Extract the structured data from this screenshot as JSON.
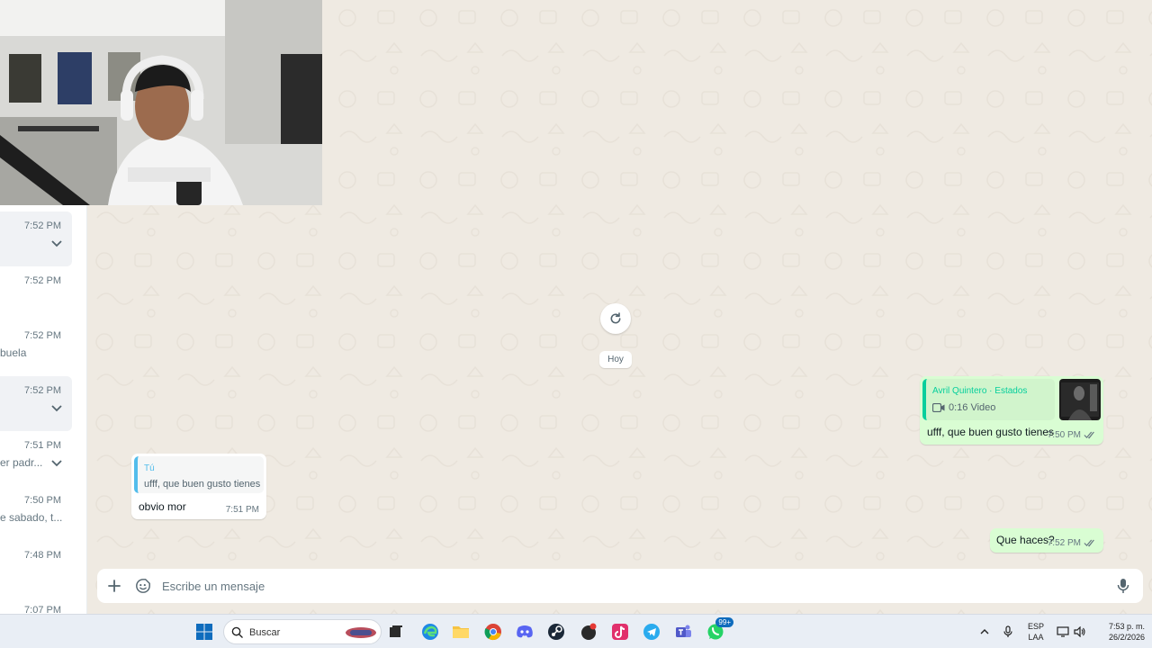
{
  "sidebar": {
    "items": [
      {
        "time": "7:52 PM",
        "preview": "",
        "chevron": true,
        "active": true
      },
      {
        "time": "7:52 PM",
        "preview": "",
        "chevron": false,
        "active": false
      },
      {
        "time": "7:52 PM",
        "preview": "buela",
        "chevron": false,
        "active": false
      },
      {
        "time": "7:52 PM",
        "preview": "",
        "chevron": true,
        "active": true
      },
      {
        "time": "7:51 PM",
        "preview": "er padr...",
        "chevron": true,
        "active": false
      },
      {
        "time": "7:50 PM",
        "preview": "e sabado, t...",
        "chevron": false,
        "active": false
      },
      {
        "time": "7:48 PM",
        "preview": "",
        "chevron": false,
        "active": false
      },
      {
        "time": "7:07 PM",
        "preview": "",
        "chevron": false,
        "active": false
      }
    ]
  },
  "chat": {
    "date_chip": "Hoy",
    "messages": {
      "status_reply": {
        "author": "Avril Quintero · Estados",
        "media": "0:16 Video",
        "text": "ufff, que buen gusto tienes",
        "time": "7:50 PM"
      },
      "incoming": {
        "quote_author": "Tú",
        "quote_text": "ufff, que buen gusto tienes",
        "text": "obvio mor",
        "time": "7:51 PM"
      },
      "outgoing": {
        "text": "Que haces?",
        "time": "7:52 PM"
      }
    }
  },
  "composer": {
    "placeholder": "Escribe un mensaje"
  },
  "taskbar": {
    "search_label": "Buscar",
    "whatsapp_badge": "99+",
    "lang_line1": "ESP",
    "lang_line2": "LAA",
    "clock_time": "7:53 p. m.",
    "clock_date": "26/2/2026"
  },
  "colors": {
    "accent_green": "#06cf9c",
    "outgoing_bubble": "#d9fdd3",
    "wallpaper": "#efeae2",
    "tick_blue": "#53bdeb"
  }
}
